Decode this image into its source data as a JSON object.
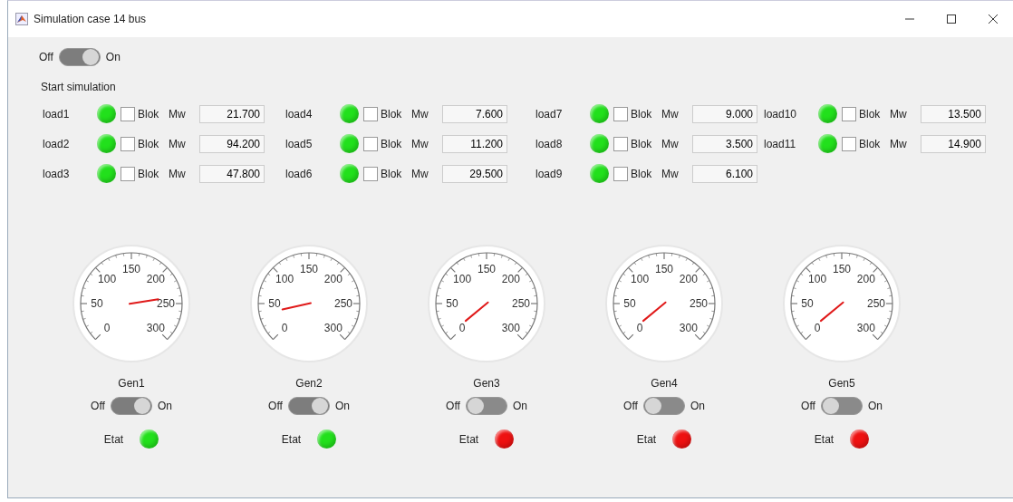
{
  "window": {
    "title": "Simulation case 14 bus"
  },
  "master_switch": {
    "off_label": "Off",
    "on_label": "On",
    "on": true
  },
  "start_label": "Start simulation",
  "load_columns": [
    [
      {
        "name": "load1",
        "color": "#22e01c",
        "blok_label": "Blok",
        "checked": false,
        "unit": "Mw",
        "value": "21.700"
      },
      {
        "name": "load2",
        "color": "#22e01c",
        "blok_label": "Blok",
        "checked": false,
        "unit": "Mw",
        "value": "94.200"
      },
      {
        "name": "load3",
        "color": "#22e01c",
        "blok_label": "Blok",
        "checked": false,
        "unit": "Mw",
        "value": "47.800"
      }
    ],
    [
      {
        "name": "load4",
        "color": "#22e01c",
        "blok_label": "Blok",
        "checked": false,
        "unit": "Mw",
        "value": "7.600"
      },
      {
        "name": "load5",
        "color": "#22e01c",
        "blok_label": "Blok",
        "checked": false,
        "unit": "Mw",
        "value": "11.200"
      },
      {
        "name": "load6",
        "color": "#22e01c",
        "blok_label": "Blok",
        "checked": false,
        "unit": "Mw",
        "value": "29.500"
      }
    ],
    [
      {
        "name": "load7",
        "color": "#22e01c",
        "blok_label": "Blok",
        "checked": false,
        "unit": "Mw",
        "value": "9.000"
      },
      {
        "name": "load8",
        "color": "#22e01c",
        "blok_label": "Blok",
        "checked": false,
        "unit": "Mw",
        "value": "3.500"
      },
      {
        "name": "load9",
        "color": "#22e01c",
        "blok_label": "Blok",
        "checked": false,
        "unit": "Mw",
        "value": "6.100"
      }
    ],
    [
      {
        "name": "load10",
        "color": "#22e01c",
        "blok_label": "Blok",
        "checked": false,
        "unit": "Mw",
        "value": "13.500"
      },
      {
        "name": "load11",
        "color": "#22e01c",
        "blok_label": "Blok",
        "checked": false,
        "unit": "Mw",
        "value": "14.900"
      }
    ]
  ],
  "generators": [
    {
      "scale": [
        "0",
        "50",
        "100",
        "150",
        "200",
        "250",
        "300"
      ],
      "name": "Gen1",
      "off_label": "Off",
      "on_label": "On",
      "on": true,
      "state_label": "Etat",
      "color": "#22e01c"
    },
    {
      "scale": [
        "0",
        "50",
        "100",
        "150",
        "200",
        "250",
        "300"
      ],
      "name": "Gen2",
      "off_label": "Off",
      "on_label": "On",
      "on": true,
      "state_label": "Etat",
      "color": "#22e01c"
    },
    {
      "scale": [
        "0",
        "50",
        "100",
        "150",
        "200",
        "250",
        "300"
      ],
      "name": "Gen3",
      "off_label": "Off",
      "on_label": "On",
      "on": false,
      "state_label": "Etat",
      "color": "#ee1111"
    },
    {
      "scale": [
        "0",
        "50",
        "100",
        "150",
        "200",
        "250",
        "300"
      ],
      "name": "Gen4",
      "off_label": "Off",
      "on_label": "On",
      "on": false,
      "state_label": "Etat",
      "color": "#ee1111"
    },
    {
      "scale": [
        "0",
        "50",
        "100",
        "150",
        "200",
        "250",
        "300"
      ],
      "name": "Gen5",
      "off_label": "Off",
      "on_label": "On",
      "on": false,
      "state_label": "Etat",
      "color": "#ee1111"
    }
  ]
}
